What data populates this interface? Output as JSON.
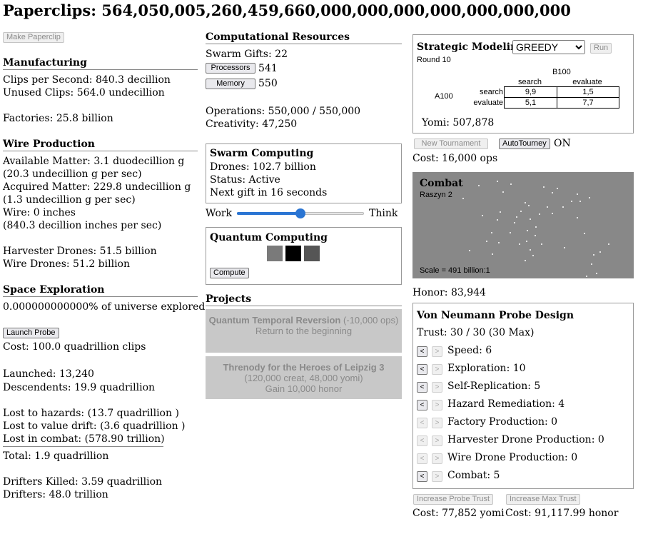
{
  "header": {
    "title": "Paperclips: 564,050,005,260,459,660,000,000,000,000,000,000,000"
  },
  "left": {
    "make_paperclip": "Make Paperclip",
    "manufacturing": {
      "heading": "Manufacturing",
      "clips_per_second": "Clips per Second: 840.3 decillion",
      "unused_clips": "Unused Clips: 564.0 undecillion",
      "factories": "Factories: 25.8 billion"
    },
    "wire": {
      "heading": "Wire Production",
      "available_matter": "Available Matter: 3.1 duodecillion g",
      "available_rate": "(20.3 undecillion g per sec)",
      "acquired_matter": "Acquired Matter: 229.8 undecillion g",
      "acquired_rate": "(1.3 undecillion g per sec)",
      "wire": "Wire: 0 inches",
      "wire_rate": "(840.3 decillion inches per sec)",
      "harvester": "Harvester Drones: 51.5 billion",
      "wire_drones": "Wire Drones: 51.2 billion"
    },
    "space": {
      "heading": "Space Exploration",
      "explored": "0.000000000000% of universe explored",
      "launch_probe": "Launch Probe",
      "cost": "Cost: 100.0 quadrillion clips",
      "launched": "Launched: 13,240",
      "descendents": "Descendents: 19.9 quadrillion",
      "lost_hazards": "Lost to hazards: (13.7 quadrillion )",
      "lost_drift": "Lost to value drift: (3.6 quadrillion )",
      "lost_combat": "Lost in combat: (578.90 trillion)",
      "total": "Total: 1.9 quadrillion",
      "drifters_killed": "Drifters Killed: 3.59 quadrillion",
      "drifters": "Drifters: 48.0 trillion"
    }
  },
  "middle": {
    "comp": {
      "heading": "Computational Resources",
      "swarm_gifts": "Swarm Gifts: 22",
      "processors_label": "Processors",
      "processors_value": "541",
      "memory_label": "Memory",
      "memory_value": "550",
      "operations": "Operations: 550,000 / 550,000",
      "creativity": "Creativity: 47,250"
    },
    "swarm": {
      "heading": "Swarm Computing",
      "drones": "Drones: 102.7 billion",
      "status": "Status: Active",
      "next_gift": "Next gift in 16 seconds",
      "work_label": "Work",
      "think_label": "Think",
      "slider_level": 0.5
    },
    "quantum": {
      "heading": "Quantum Computing",
      "chip_colors": [
        "#7a7a7a",
        "#000000",
        "#555555"
      ],
      "compute_label": "Compute"
    },
    "projects": {
      "heading": "Projects",
      "items": [
        {
          "title": "Quantum Temporal Reversion",
          "cost": "(-10,000 ops)",
          "desc": "Return to the beginning"
        },
        {
          "title": "Threnody for the Heroes of Leipzig 3",
          "cost": "(120,000 creat, 48,000 yomi)",
          "desc": "Gain 10,000 honor"
        }
      ]
    }
  },
  "right": {
    "strategic": {
      "heading": "Strategic Modeling",
      "strategy_selected": "GREEDY",
      "run_label": "Run",
      "round": "Round 10",
      "player_b": "B100",
      "player_a": "A100",
      "col_headers": [
        "search",
        "evaluate"
      ],
      "row_headers": [
        "search",
        "evaluate"
      ],
      "cells": [
        [
          "9,9",
          "1,5"
        ],
        [
          "5,1",
          "7,7"
        ]
      ],
      "yomi": "Yomi: 507,878"
    },
    "tourney": {
      "new_tournament": "New Tournament",
      "autotourney": "AutoTourney",
      "autotourney_state": "ON",
      "cost": "Cost: 16,000 ops"
    },
    "combat": {
      "heading": "Combat",
      "location": "Raszyn 2",
      "scale": "Scale = 491 billion:1",
      "background": "#888888"
    },
    "honor": "Honor: 83,944",
    "probe": {
      "heading": "Von Neumann Probe Design",
      "trust": "Trust: 30 / 30 (30 Max)",
      "stats": [
        {
          "label": "Speed: 6"
        },
        {
          "label": "Exploration: 10"
        },
        {
          "label": "Self-Replication: 5"
        },
        {
          "label": "Hazard Remediation: 4"
        },
        {
          "label": "Factory Production: 0"
        },
        {
          "label": "Harvester Drone Production: 0"
        },
        {
          "label": "Wire Drone Production: 0"
        },
        {
          "label": "Combat: 5"
        }
      ],
      "increase_trust": "Increase Probe Trust",
      "increase_trust_cost": "Cost: 77,852 yomi",
      "increase_max": "Increase Max Trust",
      "increase_max_cost": "Cost: 91,117.99 honor"
    }
  }
}
